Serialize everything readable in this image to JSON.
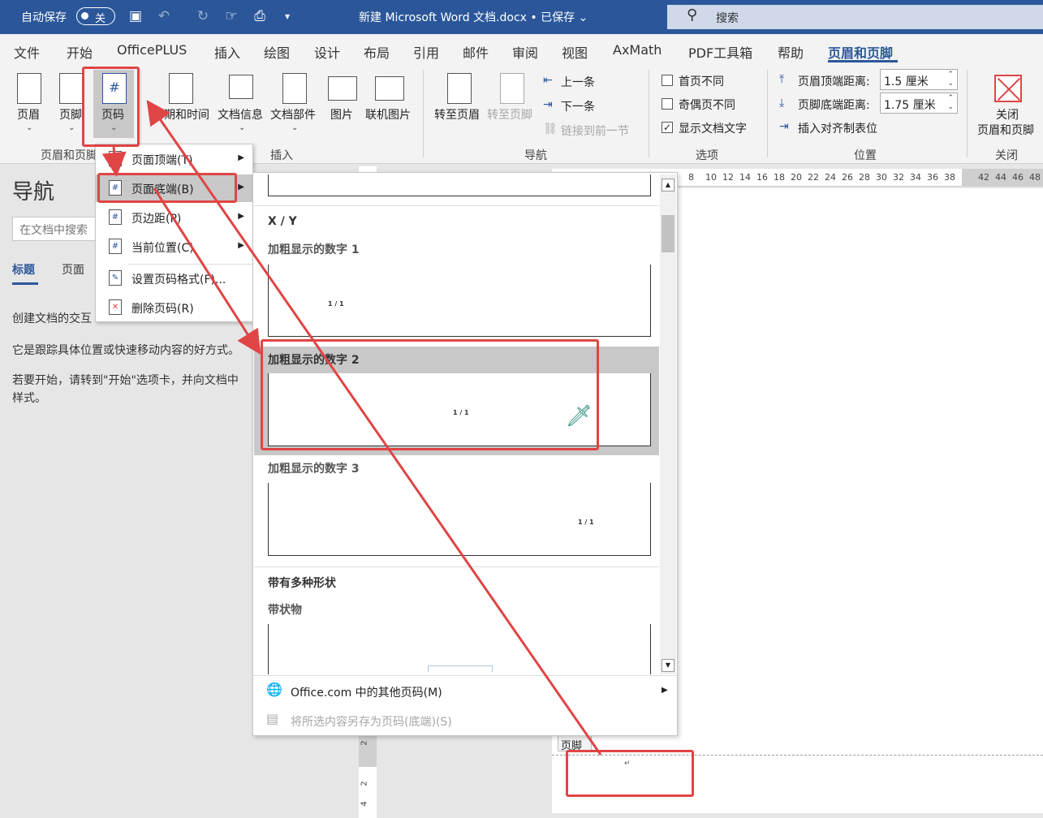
{
  "titlebar": {
    "autosave_label": "自动保存",
    "autosave_state": "关",
    "doc_title": "新建 Microsoft Word 文档.docx • 已保存 ⌄",
    "search_placeholder": "搜索"
  },
  "tabs": [
    "文件",
    "开始",
    "OfficePLUS",
    "插入",
    "绘图",
    "设计",
    "布局",
    "引用",
    "邮件",
    "审阅",
    "视图",
    "AxMath",
    "PDF工具箱",
    "帮助",
    "页眉和页脚"
  ],
  "ribbon": {
    "header": "页眉",
    "footer": "页脚",
    "page_number": "页码",
    "group_hf": "页眉和页脚",
    "datetime": "日期和时间",
    "docinfo": "文档信息",
    "docparts": "文档部件",
    "picture": "图片",
    "online_picture": "联机图片",
    "group_insert": "插入",
    "goto_header": "转至页眉",
    "goto_footer": "转至页脚",
    "prev": "上一条",
    "next": "下一条",
    "link_prev": "链接到前一节",
    "group_nav": "导航",
    "diff_first": "首页不同",
    "diff_odd_even": "奇偶页不同",
    "show_doc_text": "显示文档文字",
    "group_options": "选项",
    "header_top": "页眉顶端距离:",
    "header_top_value": "1.5 厘米",
    "footer_bottom": "页脚底端距离:",
    "footer_bottom_value": "1.75 厘米",
    "insert_align_tab": "插入对齐制表位",
    "group_position": "位置",
    "close_hf": "关闭",
    "close_hf2": "页眉和页脚",
    "group_close": "关闭"
  },
  "nav": {
    "title": "导航",
    "search_placeholder": "在文档中搜索",
    "tab_headings": "标题",
    "tab_pages": "页面",
    "p1": "创建文档的交互",
    "p2": "它是跟踪具体位置或快速移动内容的好方式。",
    "p3a": "若要开始，请转到\"开始\"选项卡，并向文档中",
    "p3b": "样式。"
  },
  "menu": {
    "top": "页面顶端(T)",
    "bottom": "页面底端(B)",
    "margin": "页边距(P)",
    "current": "当前位置(C)",
    "format": "设置页码格式(F)...",
    "remove": "删除页码(R)"
  },
  "gallery": {
    "section_xy": "X / Y",
    "item1": "加粗显示的数字 1",
    "item2": "加粗显示的数字 2",
    "item3": "加粗显示的数字 3",
    "section_shapes": "带有多种形状",
    "item_ribbon": "带状物",
    "sample": "1 / 1",
    "more": "Office.com 中的其他页码(M)",
    "save_selection": "将所选内容另存为页码(底端)(S)"
  },
  "ruler": [
    "8",
    "10",
    "12",
    "14",
    "16",
    "18",
    "20",
    "22",
    "24",
    "26",
    "28",
    "30",
    "32",
    "34",
    "36",
    "38",
    "42",
    "44",
    "46",
    "48"
  ],
  "vruler": [
    "2",
    "2",
    "4"
  ],
  "footer_label": "页脚",
  "colors": {
    "accent": "#2b579a",
    "annotation": "#e04545"
  }
}
